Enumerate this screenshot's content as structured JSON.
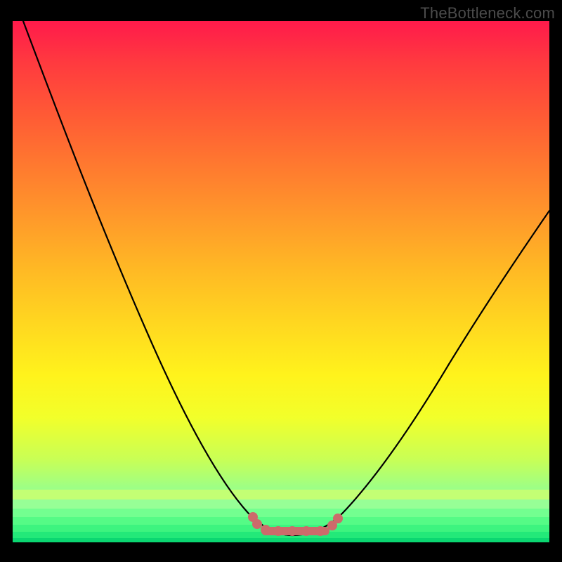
{
  "watermark": "TheBottleneck.com",
  "chart_data": {
    "type": "line",
    "title": "",
    "xlabel": "",
    "ylabel": "",
    "xlim": [
      0,
      100
    ],
    "ylim": [
      0,
      100
    ],
    "grid": false,
    "legend": false,
    "series": [
      {
        "name": "curve",
        "x": [
          2,
          6,
          10,
          14,
          18,
          22,
          26,
          30,
          34,
          38,
          42,
          45,
          48,
          50,
          52,
          55,
          58,
          62,
          66,
          72,
          80,
          90,
          100
        ],
        "y": [
          100,
          93,
          85,
          77,
          69,
          61,
          53,
          45,
          37,
          29,
          21,
          14,
          8,
          4,
          2,
          1,
          1,
          4,
          9,
          17,
          28,
          41,
          55
        ]
      }
    ],
    "markers": {
      "name": "highlight-dots",
      "x": [
        45,
        46,
        48,
        50,
        52,
        54,
        56,
        59,
        60
      ],
      "y": [
        7,
        5,
        3,
        2,
        2,
        2,
        2,
        3,
        5
      ]
    },
    "gradient_stops": [
      {
        "pos": 0.0,
        "color": "#ff1a4b"
      },
      {
        "pos": 0.18,
        "color": "#ff5a35"
      },
      {
        "pos": 0.38,
        "color": "#ff9a2a"
      },
      {
        "pos": 0.58,
        "color": "#ffd720"
      },
      {
        "pos": 0.76,
        "color": "#f2ff2a"
      },
      {
        "pos": 0.92,
        "color": "#8aff9b"
      },
      {
        "pos": 1.0,
        "color": "#2cf87f"
      }
    ]
  }
}
